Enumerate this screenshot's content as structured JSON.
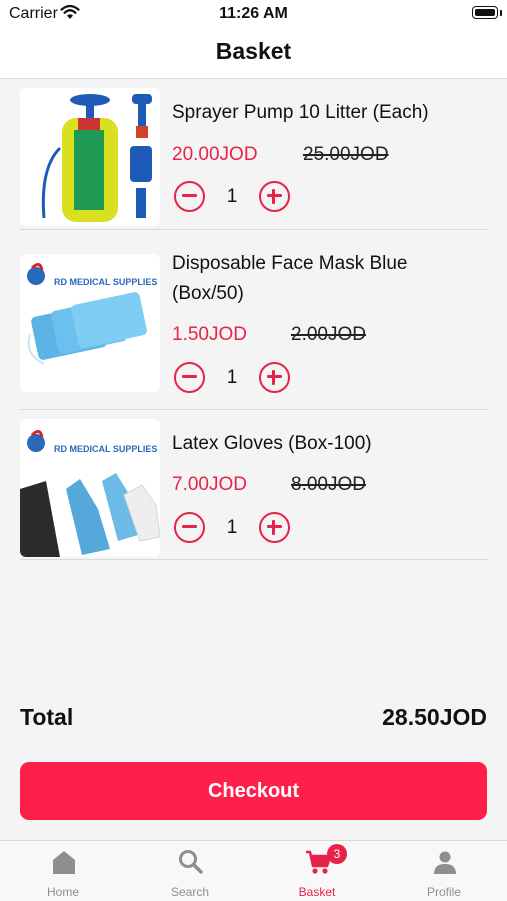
{
  "status_bar": {
    "carrier": "Carrier",
    "time": "11:26 AM"
  },
  "header": {
    "title": "Basket"
  },
  "colors": {
    "accent": "#e8234a",
    "checkout": "#ff1f4b",
    "icon_gray": "#8e8e8e"
  },
  "items": [
    {
      "name": "Sprayer Pump 10 Litter (Each)",
      "price": "20.00JOD",
      "old_price": "25.00JOD",
      "quantity": "1",
      "image_label": ""
    },
    {
      "name": "Disposable Face Mask Blue (Box/50)",
      "price": "1.50JOD",
      "old_price": "2.00JOD",
      "quantity": "1",
      "image_label": "RD MEDICAL SUPPLIES"
    },
    {
      "name": "Latex Gloves (Box-100)",
      "price": "7.00JOD",
      "old_price": "8.00JOD",
      "quantity": "1",
      "image_label": "RD MEDICAL SUPPLIES"
    }
  ],
  "summary": {
    "total_label": "Total",
    "total_value": "28.50JOD"
  },
  "checkout": {
    "label": "Checkout"
  },
  "tabs": [
    {
      "label": "Home",
      "icon": "home-icon"
    },
    {
      "label": "Search",
      "icon": "search-icon"
    },
    {
      "label": "Basket",
      "icon": "cart-icon",
      "badge": "3",
      "active": true
    },
    {
      "label": "Profile",
      "icon": "person-icon"
    }
  ]
}
